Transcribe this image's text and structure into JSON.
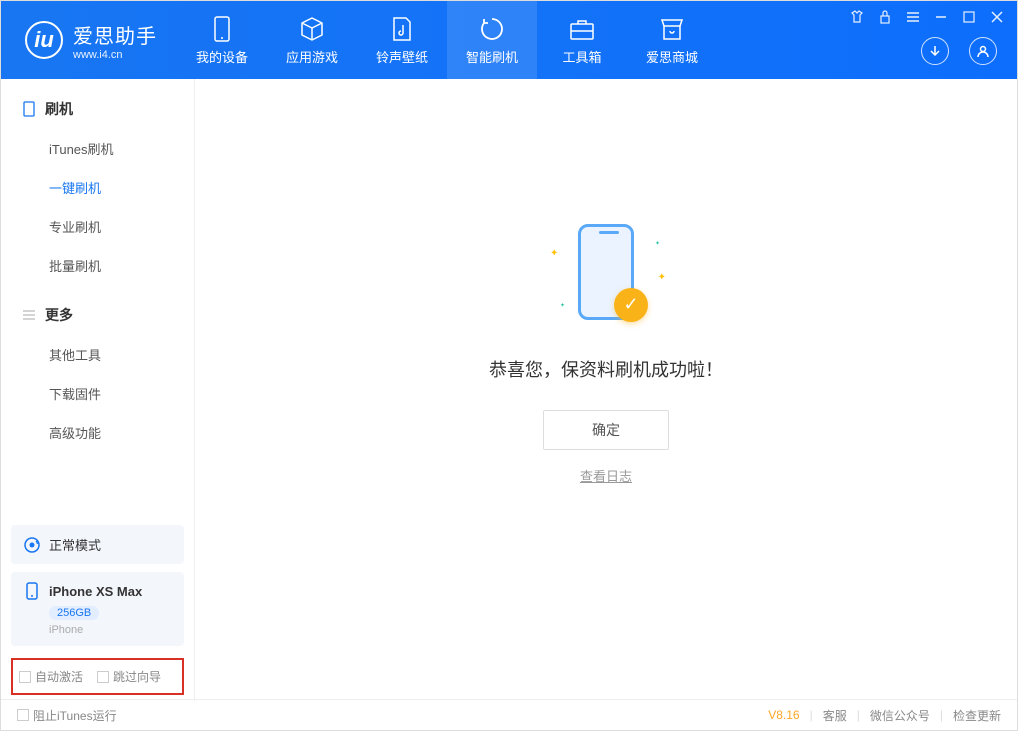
{
  "app": {
    "title": "爱思助手",
    "subtitle": "www.i4.cn"
  },
  "tabs": {
    "device": "我的设备",
    "apps": "应用游戏",
    "ringtone": "铃声壁纸",
    "flash": "智能刷机",
    "toolbox": "工具箱",
    "store": "爱思商城"
  },
  "sidebar": {
    "group1": {
      "title": "刷机",
      "items": {
        "itunes": "iTunes刷机",
        "oneclick": "一键刷机",
        "pro": "专业刷机",
        "batch": "批量刷机"
      }
    },
    "group2": {
      "title": "更多",
      "items": {
        "other": "其他工具",
        "firmware": "下载固件",
        "advanced": "高级功能"
      }
    }
  },
  "device": {
    "mode": "正常模式",
    "name": "iPhone XS Max",
    "capacity": "256GB",
    "type": "iPhone"
  },
  "options": {
    "auto_activate": "自动激活",
    "skip_guide": "跳过向导"
  },
  "main": {
    "success_text": "恭喜您，保资料刷机成功啦！",
    "ok_button": "确定",
    "view_log": "查看日志"
  },
  "footer": {
    "block_itunes": "阻止iTunes运行",
    "version": "V8.16",
    "service": "客服",
    "wechat": "微信公众号",
    "update": "检查更新"
  }
}
